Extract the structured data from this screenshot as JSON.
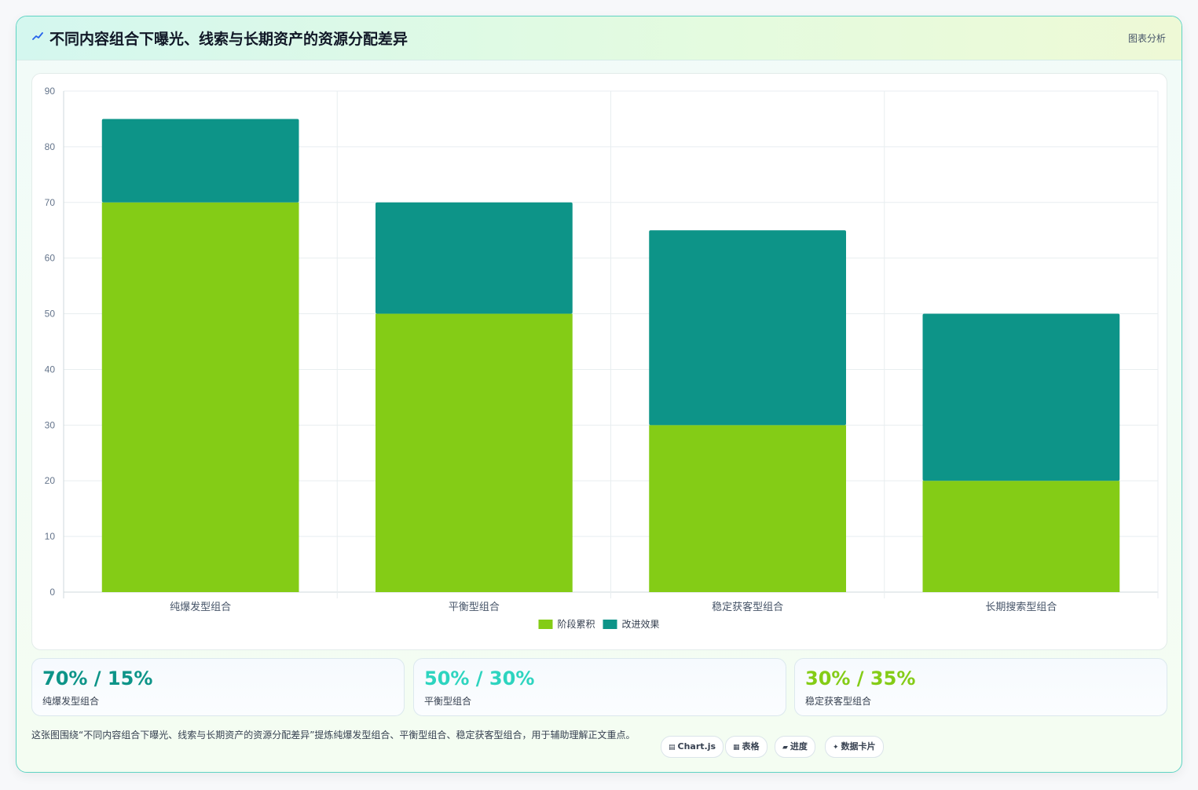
{
  "header": {
    "title": "不同内容组合下曝光、线索与长期资产的资源分配差异",
    "tag": "图表分析"
  },
  "chart_data": {
    "type": "bar",
    "stacked": true,
    "categories": [
      "纯爆发型组合",
      "平衡型组合",
      "稳定获客型组合",
      "长期搜索型组合"
    ],
    "series": [
      {
        "name": "阶段累积",
        "values": [
          70,
          50,
          30,
          20
        ],
        "color": "#84cc16"
      },
      {
        "name": "改进效果",
        "values": [
          15,
          20,
          35,
          30
        ],
        "color": "#0d9488"
      }
    ],
    "ylim": [
      0,
      90
    ],
    "yticks": [
      0,
      10,
      20,
      30,
      40,
      50,
      60,
      70,
      80,
      90
    ],
    "grid": true,
    "legend_position": "bottom"
  },
  "stats": [
    {
      "value": "70% / 15%",
      "label": "纯爆发型组合",
      "color": "#0d9488"
    },
    {
      "value": "50% / 30%",
      "label": "平衡型组合",
      "color": "#2dd4bf"
    },
    {
      "value": "30% / 35%",
      "label": "稳定获客型组合",
      "color": "#84cc16"
    }
  ],
  "footer": {
    "description": "这张图围绕“不同内容组合下曝光、线索与长期资产的资源分配差异”提炼纯爆发型组合、平衡型组合、稳定获客型组合，用于辅助理解正文重点。",
    "pills": [
      {
        "label": "Chart.js",
        "icon": "chart-icon"
      },
      {
        "label": "表格",
        "icon": "table-icon"
      },
      {
        "label": "进度",
        "icon": "progress-icon"
      },
      {
        "label": "数据卡片",
        "icon": "sparkle-icon"
      }
    ]
  }
}
